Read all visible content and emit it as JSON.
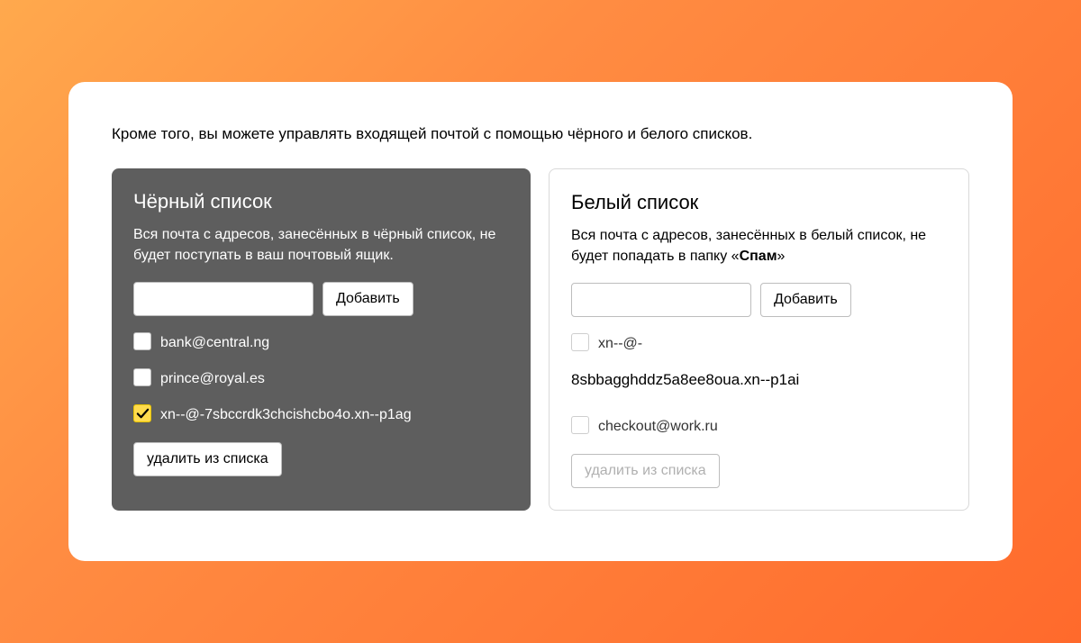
{
  "intro": "Кроме того, вы можете управлять входящей почтой с помощью чёрного и белого списков.",
  "blacklist": {
    "title": "Чёрный список",
    "desc": "Вся почта с адресов, занесённых в чёрный список, не будет поступать в ваш почтовый ящик.",
    "input_value": "",
    "add_label": "Добавить",
    "items": [
      {
        "email": "bank@central.ng",
        "checked": false
      },
      {
        "email": "prince@royal.es",
        "checked": false
      },
      {
        "email": "xn--@-7sbccrdk3chcishcbo4o.xn--p1ag",
        "checked": true
      }
    ],
    "remove_label": "удалить из списка"
  },
  "whitelist": {
    "title": "Белый список",
    "desc_pre": "Вся почта с адресов, занесённых в белый список, не будет попадать в папку «",
    "desc_bold": "Спам",
    "desc_post": "»",
    "input_value": "",
    "add_label": "Добавить",
    "items": [
      {
        "email_line1": "xn--@-",
        "email_line2": "8sbbagghddz5a8ee8oua.xn--p1ai",
        "checked": false
      },
      {
        "email_line1": "checkout@work.ru",
        "email_line2": "",
        "checked": false
      }
    ],
    "remove_label": "удалить из списка"
  }
}
